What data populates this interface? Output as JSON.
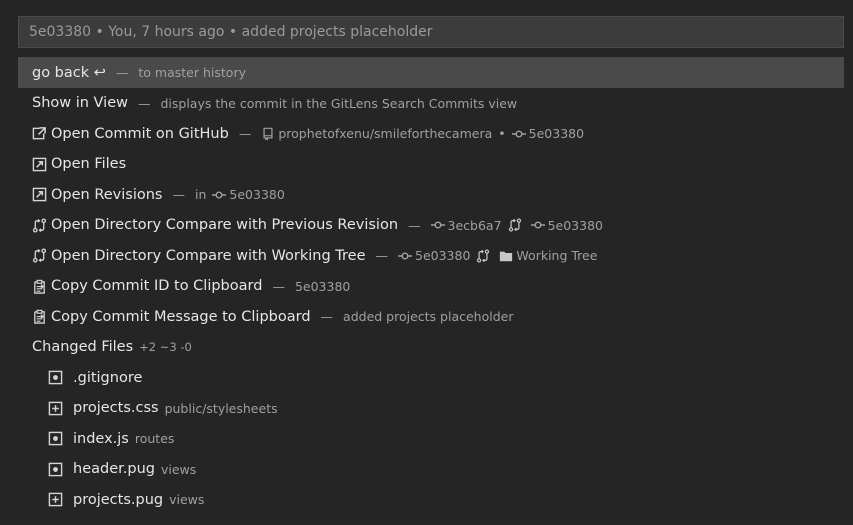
{
  "quickpick": {
    "placeholder": "5e03380 • You, 7 hours ago • added projects placeholder",
    "rows": {
      "go_back": {
        "label": "go back ↩",
        "sep": "—",
        "desc": "to master history"
      },
      "show_in_view": {
        "label": "Show in View",
        "sep": "—",
        "desc": "displays the commit in the GitLens Search Commits view"
      },
      "open_commit_github": {
        "label": "Open Commit on GitHub",
        "sep": "—",
        "repo": "prophetofxenu/smileforthecamera",
        "dot": "•",
        "sha": "5e03380"
      },
      "open_files": {
        "label": "Open Files"
      },
      "open_revisions": {
        "label": "Open Revisions",
        "sep": "—",
        "in": "in",
        "sha": "5e03380"
      },
      "compare_previous": {
        "label": "Open Directory Compare with Previous Revision",
        "sep": "—",
        "sha_from": "3ecb6a7",
        "sha_to": "5e03380"
      },
      "compare_working": {
        "label": "Open Directory Compare with Working Tree",
        "sep": "—",
        "sha": "5e03380",
        "target": "Working Tree"
      },
      "copy_id": {
        "label": "Copy Commit ID to Clipboard",
        "sep": "—",
        "desc": "5e03380"
      },
      "copy_message": {
        "label": "Copy Commit Message to Clipboard",
        "sep": "—",
        "desc": "added projects placeholder"
      },
      "changed_files": {
        "label": "Changed Files",
        "counts": "+2 ~3 -0"
      }
    },
    "files": [
      {
        "name": ".gitignore",
        "dir": "",
        "status_icon": "modified-icon"
      },
      {
        "name": "projects.css",
        "dir": "public/stylesheets",
        "status_icon": "added-icon"
      },
      {
        "name": "index.js",
        "dir": "routes",
        "status_icon": "modified-icon"
      },
      {
        "name": "header.pug",
        "dir": "views",
        "status_icon": "modified-icon"
      },
      {
        "name": "projects.pug",
        "dir": "views",
        "status_icon": "added-icon"
      }
    ]
  },
  "colors": {
    "background": "#252526",
    "active_row": "#4a4a4a",
    "input": "#3c3c3c",
    "text": "#d4d4d4",
    "muted": "#a0a0a0"
  }
}
